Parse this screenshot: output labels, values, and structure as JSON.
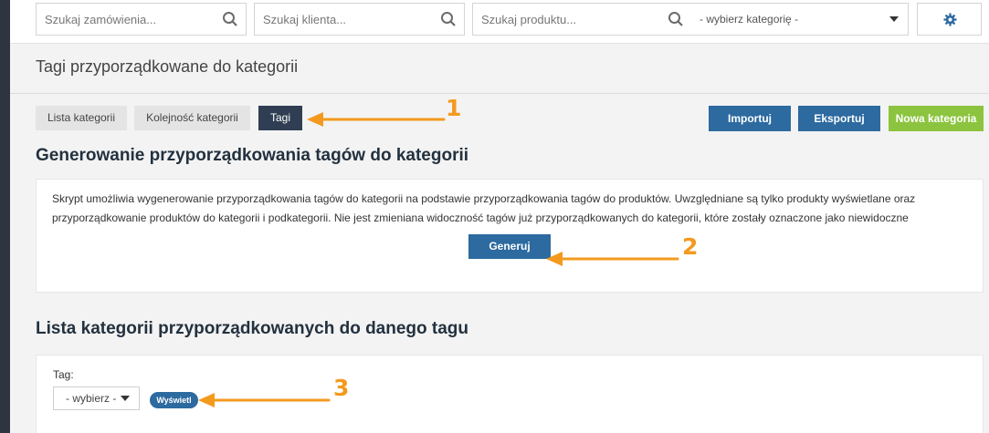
{
  "topbar": {
    "order_search_placeholder": "Szukaj zamówienia...",
    "client_search_placeholder": "Szukaj klienta...",
    "product_search_placeholder": "Szukaj produktu...",
    "category_select_value": "- wybierz kategorię -"
  },
  "page": {
    "title": "Tagi przyporządkowane do kategorii"
  },
  "tabs": [
    {
      "label": "Lista kategorii",
      "active": false
    },
    {
      "label": "Kolejność kategorii",
      "active": false
    },
    {
      "label": "Tagi",
      "active": true
    }
  ],
  "actions": {
    "import_label": "Importuj",
    "export_label": "Eksportuj",
    "new_category_label": "Nowa kategoria"
  },
  "generate_section": {
    "heading": "Generowanie przyporządkowania tagów do kategorii",
    "description": "Skrypt umożliwia wygenerowanie przyporządkowania tagów do kategorii na podstawie przyporządkowania tagów do produktów. Uwzględniane są tylko produkty wyświetlane oraz przyporządkowanie produktów do kategorii i podkategorii. Nie jest zmieniana widoczność tagów już przyporządkowanych do kategorii, które zostały oznaczone jako niewidoczne",
    "button_label": "Generuj"
  },
  "list_section": {
    "heading": "Lista kategorii przyporządkowanych do danego tagu",
    "tag_label": "Tag:",
    "tag_select_value": "- wybierz -",
    "show_button_label": "Wyświetl"
  },
  "annotations": {
    "marker_1": "1",
    "marker_2": "2",
    "marker_3": "3"
  },
  "colors": {
    "accent_blue": "#2c6aa0",
    "active_tab": "#2f3e53",
    "new_category_green": "#8cc43f",
    "annotation_orange": "#f39a1e"
  }
}
